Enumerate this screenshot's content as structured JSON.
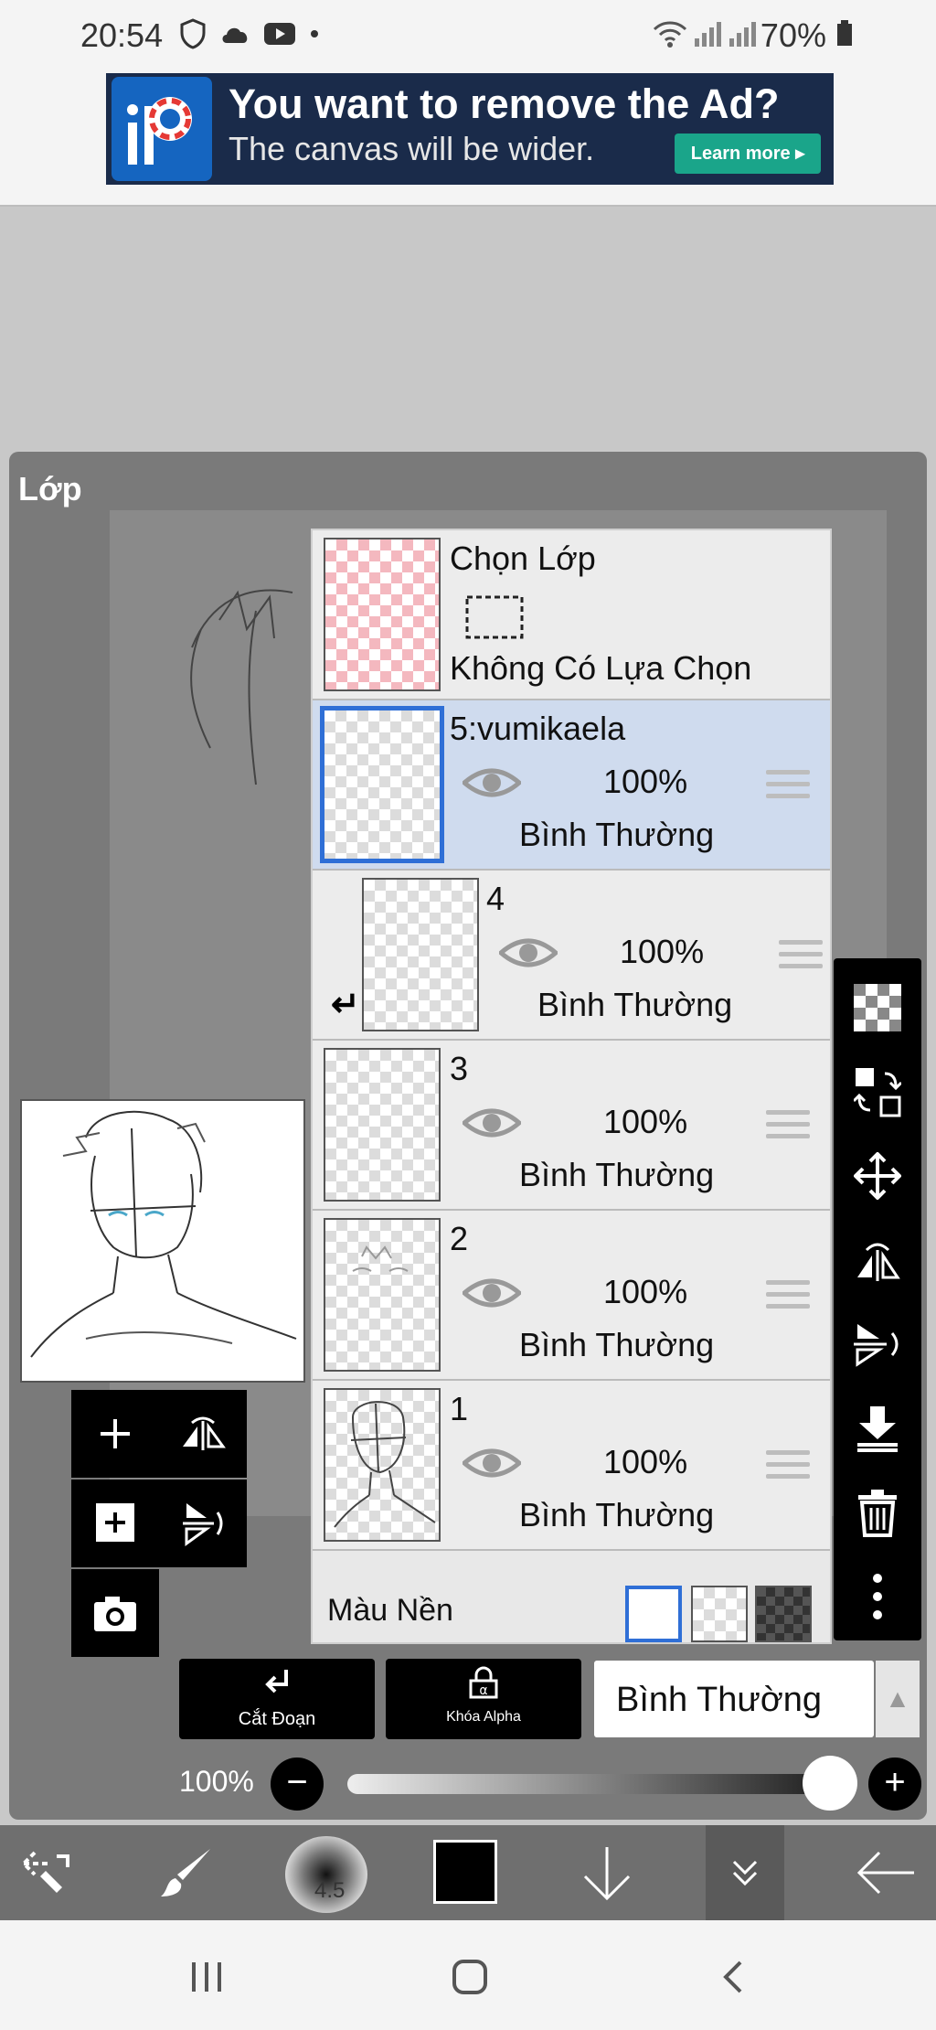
{
  "status_bar": {
    "time": "20:54",
    "battery": "70%"
  },
  "ad": {
    "title": "You want to remove the Ad?",
    "subtitle": "The canvas will be wider.",
    "learn_more": "Learn more ▸"
  },
  "panel": {
    "title": "Lớp"
  },
  "select_layer": {
    "title": "Chọn Lớp",
    "status": "Không Có Lựa Chọn"
  },
  "layers": [
    {
      "name": "5:vumikaela",
      "opacity": "100%",
      "blend": "Bình Thường",
      "selected": true
    },
    {
      "name": "4",
      "opacity": "100%",
      "blend": "Bình Thường",
      "clipped": true
    },
    {
      "name": "3",
      "opacity": "100%",
      "blend": "Bình Thường"
    },
    {
      "name": "2",
      "opacity": "100%",
      "blend": "Bình Thường"
    },
    {
      "name": "1",
      "opacity": "100%",
      "blend": "Bình Thường"
    }
  ],
  "background": {
    "label": "Màu Nền"
  },
  "bottom_controls": {
    "clipping_label": "Cắt Đoạn",
    "alpha_lock_label": "Khóa Alpha",
    "blend_mode": "Bình Thường",
    "opacity": "100%",
    "opacity_level": 1.0
  },
  "toolbar": {
    "brush_size": "4.5"
  },
  "colors": {
    "selected_blue": "#2f6fd6",
    "selected_row": "#cfdbee",
    "ad_accent": "#1aa58a"
  }
}
